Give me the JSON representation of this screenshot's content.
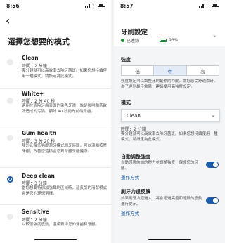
{
  "left": {
    "status_time": "8:56",
    "title": "選擇您想要的模式",
    "modes": [
      {
        "name": "Clean",
        "time": "時間：2 分鐘",
        "desc": "獨分鐘就可以高效率去除牙菌斑。如果您想持續使用一種模式，請設定為此模式。",
        "selected": false
      },
      {
        "name": "White+",
        "time": "時間：2 分 40 秒",
        "desc": "適用於清除牙齒表面的染色牙漬，像是咖啡和茶飲所造成的污漬。額外 40 秒拋光前端牙齒。",
        "selected": false
      },
      {
        "name": "Gum health",
        "time": "時間：3 分 20 秒",
        "desc": "額外延長低強度潔牙模式刷牙時間，可以溫和按摩牙齦，改善您這積處您對牙齦牙齦健康。",
        "selected": false
      },
      {
        "name": "Deep clean",
        "time": "時間：3 分鐘",
        "desc": "當您想要特別加強難刷區域時，延長版的清潔模式會是您的理想選擇。",
        "selected": true
      },
      {
        "name": "Sensitive",
        "time": "時間：2 分鐘",
        "desc": "以較低強度震動，溫柔對待您的牙齒和牙齦。",
        "selected": false
      }
    ]
  },
  "right": {
    "status_time": "8:57",
    "title": "牙刷設定",
    "connection": "已連線",
    "battery": "93%",
    "intensity_label": "強度",
    "intensity_options": [
      "低",
      "中",
      "高"
    ],
    "intensity_selected": 1,
    "intensity_note": "強度設定可以調整牙刷動作的力度，讓您感受舒適潔牙。為了達到最佳效果，建議使用高強度設定。",
    "mode_label": "模式",
    "mode_value": "Clean",
    "mode_time": "時間：2 分鐘",
    "mode_note": "獨分鐘就可以高效率去除牙菌斑。如果您想持續使用一種模式，請設定為此模式。",
    "auto_intensity": {
      "title": "自動調整強度",
      "desc": "自動感應施加的壓力並調整強度，保護您的牙齦。",
      "link": "運作方式",
      "enabled": true
    },
    "pressure": {
      "title": "刷牙力道反饋",
      "desc": "如果刷牙力道過大，將會透過亮燈和輕微的震動進行提示。",
      "link": "運作方式",
      "enabled": true
    }
  },
  "colors": {
    "accent": "#1b5cab",
    "connected": "#2a8a3c",
    "panel": "#f4f5f7"
  },
  "icons": {
    "back": "chevron-left-icon",
    "expand": "chevron-down-icon",
    "select": "chevron-down-icon"
  }
}
